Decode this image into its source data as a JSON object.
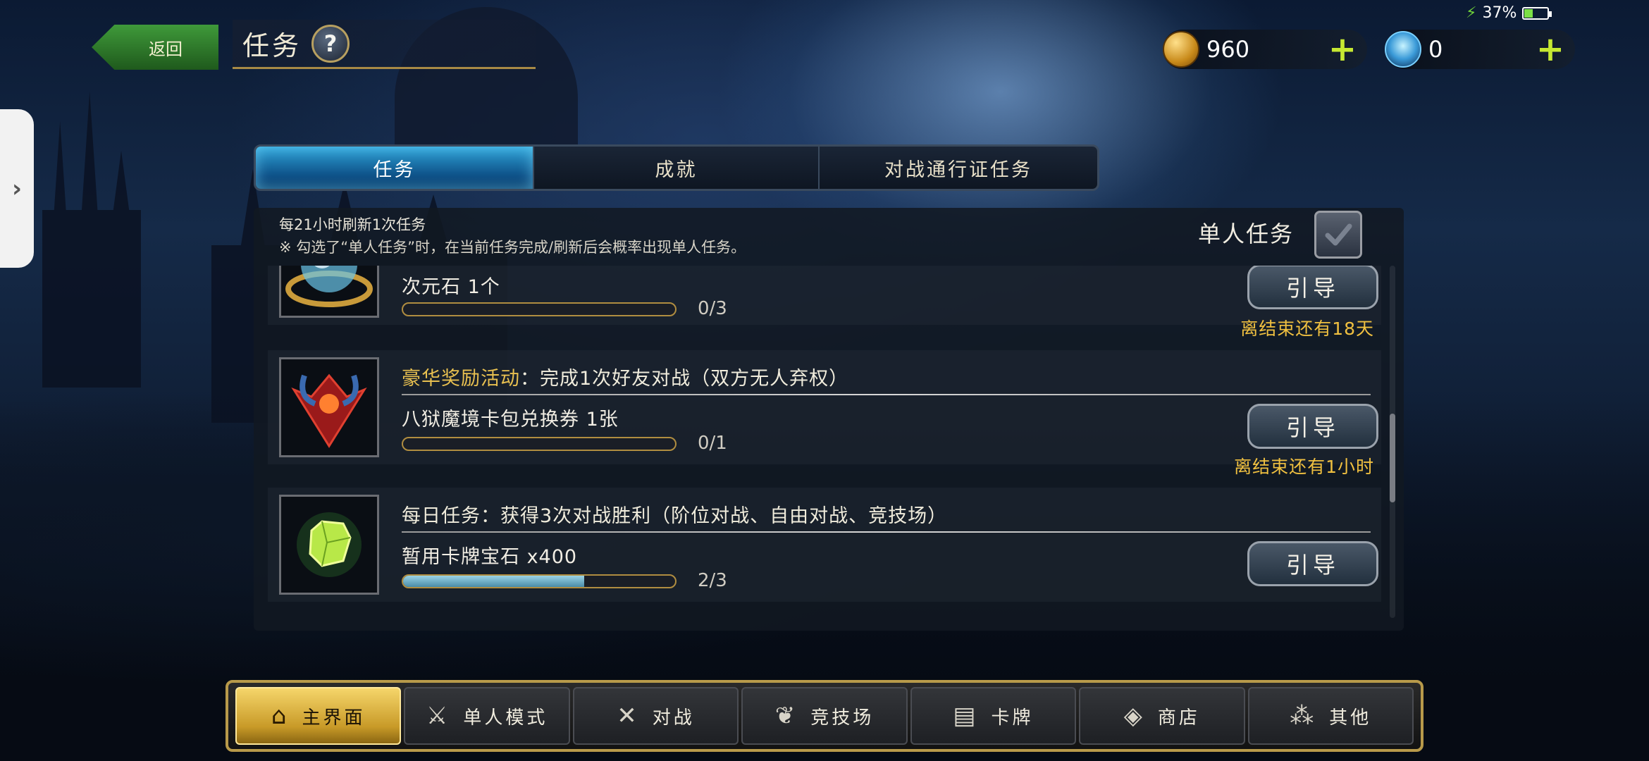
{
  "status": {
    "battery_percent": "37",
    "battery_unit": "%",
    "battery_level": 0.37
  },
  "header": {
    "back_label": "返回",
    "title": "任务",
    "help_icon": "?"
  },
  "currency": {
    "gold_value": "960",
    "gem_value": "0",
    "add_symbol": "+"
  },
  "tabs": [
    {
      "label": "任务",
      "active": true
    },
    {
      "label": "成就",
      "active": false
    },
    {
      "label": "对战通行证任务",
      "active": false
    }
  ],
  "panel": {
    "refresh_text": "每21小时刷新1次任务",
    "note_text": "※ 勾选了“单人任务”时，在当前任务完成/刷新后会概率出现单人任务。",
    "solo_label": "单人任务",
    "solo_checked": true
  },
  "tasks": [
    {
      "reward": "次元石 1个",
      "progress_text": "0/3",
      "progress": 0,
      "guide_label": "引导",
      "deadline": "离结束还有18天"
    },
    {
      "tag": "豪华奖励活动",
      "header_rest": "：完成1次好友对战（双方无人弃权）",
      "reward": "八狱魔境卡包兑换券 1张",
      "progress_text": "0/1",
      "progress": 0,
      "guide_label": "引导",
      "deadline": "离结束还有1小时"
    },
    {
      "header": "每日任务：获得3次对战胜利（阶位对战、自由对战、竞技场）",
      "reward": "暂用卡牌宝石 x400",
      "progress_text": "2/3",
      "progress": 0.6667,
      "guide_label": "引导"
    }
  ],
  "nav": [
    {
      "label": "主界面",
      "icon": "home-icon",
      "active": true
    },
    {
      "label": "单人模式",
      "icon": "sword-shield-icon",
      "active": false
    },
    {
      "label": "对战",
      "icon": "crossed-swords-icon",
      "active": false
    },
    {
      "label": "竞技场",
      "icon": "laurel-icon",
      "active": false
    },
    {
      "label": "卡牌",
      "icon": "cards-icon",
      "active": false
    },
    {
      "label": "商店",
      "icon": "shop-icon",
      "active": false
    },
    {
      "label": "其他",
      "icon": "dots-icon",
      "active": false
    }
  ]
}
